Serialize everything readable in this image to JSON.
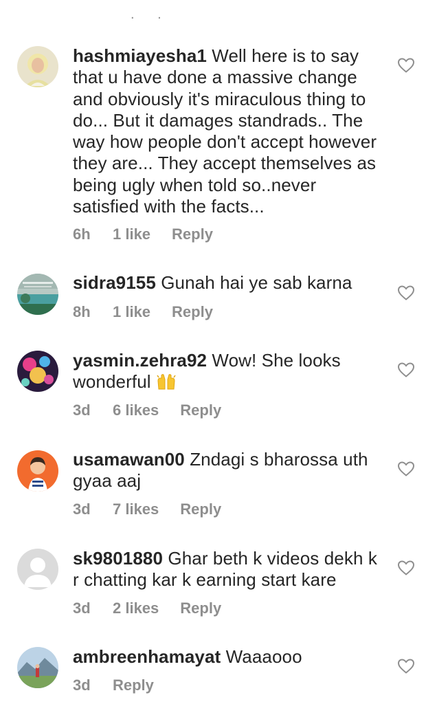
{
  "top_indicator": ". .",
  "comments": [
    {
      "username": "hashmiayesha1",
      "text": "Well here is to say that u have done a massive change and obviously it's miraculous thing to do... But it damages standrads.. The way how people don't accept however they are... They accept themselves as being ugly when told so..never satisfied with the facts...",
      "time": "6h",
      "likes": "1 like",
      "reply": "Reply",
      "avatar_icon": "woman-hijab-avatar",
      "like_icon": "heart-outline-icon"
    },
    {
      "username": "sidra9155",
      "text": "Gunah  hai ye sab karna",
      "time": "8h",
      "likes": "1 like",
      "reply": "Reply",
      "avatar_icon": "landscape-avatar",
      "like_icon": "heart-outline-icon"
    },
    {
      "username": "yasmin.zehra92",
      "text": "Wow! She looks wonderful",
      "emoji": "raising-hands",
      "time": "3d",
      "likes": "6 likes",
      "reply": "Reply",
      "avatar_icon": "colorful-photo-avatar",
      "like_icon": "heart-outline-icon"
    },
    {
      "username": "usamawan00",
      "text": "Zndagi s bharossa uth gyaa aaj",
      "time": "3d",
      "likes": "7 likes",
      "reply": "Reply",
      "avatar_icon": "cartoon-boy-avatar",
      "like_icon": "heart-outline-icon"
    },
    {
      "username": "sk9801880",
      "text": "Ghar beth k videos dekh k r chatting kar k earning start kare",
      "time": "3d",
      "likes": "2 likes",
      "reply": "Reply",
      "avatar_icon": "default-user-avatar",
      "like_icon": "heart-outline-icon"
    },
    {
      "username": "ambreenhamayat",
      "text": "Waaaooo",
      "time": "3d",
      "likes": "",
      "reply": "Reply",
      "avatar_icon": "mountain-landscape-avatar",
      "like_icon": "heart-outline-icon"
    }
  ]
}
